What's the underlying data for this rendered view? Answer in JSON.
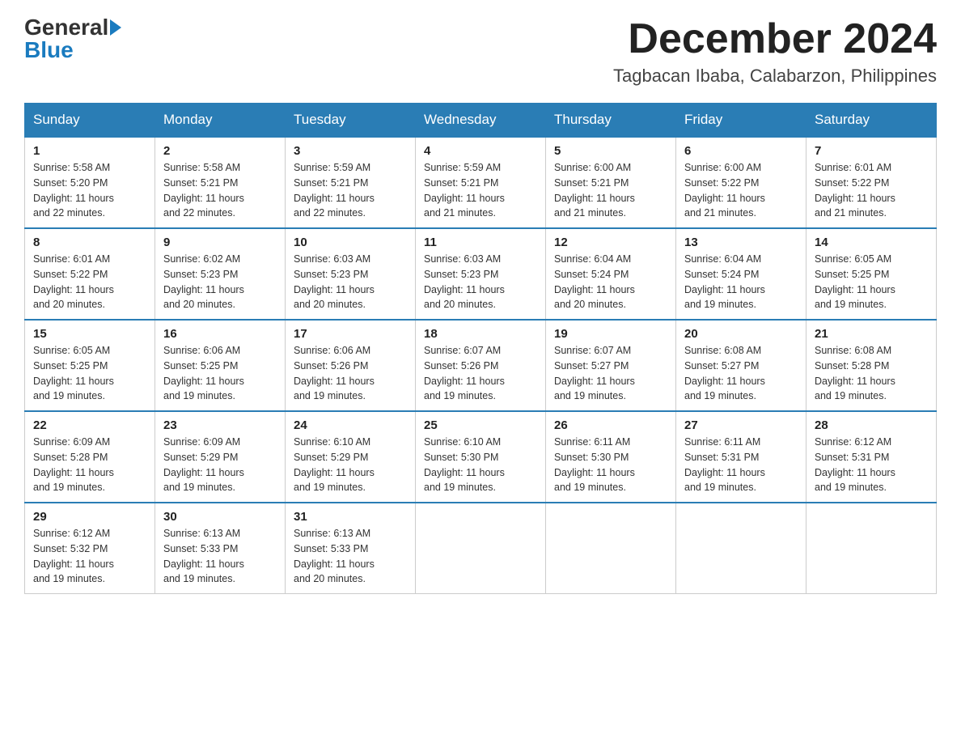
{
  "logo": {
    "general": "General",
    "blue": "Blue"
  },
  "header": {
    "month_year": "December 2024",
    "location": "Tagbacan Ibaba, Calabarzon, Philippines"
  },
  "days_of_week": [
    "Sunday",
    "Monday",
    "Tuesday",
    "Wednesday",
    "Thursday",
    "Friday",
    "Saturday"
  ],
  "weeks": [
    [
      {
        "day": "1",
        "sunrise": "5:58 AM",
        "sunset": "5:20 PM",
        "daylight": "11 hours and 22 minutes."
      },
      {
        "day": "2",
        "sunrise": "5:58 AM",
        "sunset": "5:21 PM",
        "daylight": "11 hours and 22 minutes."
      },
      {
        "day": "3",
        "sunrise": "5:59 AM",
        "sunset": "5:21 PM",
        "daylight": "11 hours and 22 minutes."
      },
      {
        "day": "4",
        "sunrise": "5:59 AM",
        "sunset": "5:21 PM",
        "daylight": "11 hours and 21 minutes."
      },
      {
        "day": "5",
        "sunrise": "6:00 AM",
        "sunset": "5:21 PM",
        "daylight": "11 hours and 21 minutes."
      },
      {
        "day": "6",
        "sunrise": "6:00 AM",
        "sunset": "5:22 PM",
        "daylight": "11 hours and 21 minutes."
      },
      {
        "day": "7",
        "sunrise": "6:01 AM",
        "sunset": "5:22 PM",
        "daylight": "11 hours and 21 minutes."
      }
    ],
    [
      {
        "day": "8",
        "sunrise": "6:01 AM",
        "sunset": "5:22 PM",
        "daylight": "11 hours and 20 minutes."
      },
      {
        "day": "9",
        "sunrise": "6:02 AM",
        "sunset": "5:23 PM",
        "daylight": "11 hours and 20 minutes."
      },
      {
        "day": "10",
        "sunrise": "6:03 AM",
        "sunset": "5:23 PM",
        "daylight": "11 hours and 20 minutes."
      },
      {
        "day": "11",
        "sunrise": "6:03 AM",
        "sunset": "5:23 PM",
        "daylight": "11 hours and 20 minutes."
      },
      {
        "day": "12",
        "sunrise": "6:04 AM",
        "sunset": "5:24 PM",
        "daylight": "11 hours and 20 minutes."
      },
      {
        "day": "13",
        "sunrise": "6:04 AM",
        "sunset": "5:24 PM",
        "daylight": "11 hours and 19 minutes."
      },
      {
        "day": "14",
        "sunrise": "6:05 AM",
        "sunset": "5:25 PM",
        "daylight": "11 hours and 19 minutes."
      }
    ],
    [
      {
        "day": "15",
        "sunrise": "6:05 AM",
        "sunset": "5:25 PM",
        "daylight": "11 hours and 19 minutes."
      },
      {
        "day": "16",
        "sunrise": "6:06 AM",
        "sunset": "5:25 PM",
        "daylight": "11 hours and 19 minutes."
      },
      {
        "day": "17",
        "sunrise": "6:06 AM",
        "sunset": "5:26 PM",
        "daylight": "11 hours and 19 minutes."
      },
      {
        "day": "18",
        "sunrise": "6:07 AM",
        "sunset": "5:26 PM",
        "daylight": "11 hours and 19 minutes."
      },
      {
        "day": "19",
        "sunrise": "6:07 AM",
        "sunset": "5:27 PM",
        "daylight": "11 hours and 19 minutes."
      },
      {
        "day": "20",
        "sunrise": "6:08 AM",
        "sunset": "5:27 PM",
        "daylight": "11 hours and 19 minutes."
      },
      {
        "day": "21",
        "sunrise": "6:08 AM",
        "sunset": "5:28 PM",
        "daylight": "11 hours and 19 minutes."
      }
    ],
    [
      {
        "day": "22",
        "sunrise": "6:09 AM",
        "sunset": "5:28 PM",
        "daylight": "11 hours and 19 minutes."
      },
      {
        "day": "23",
        "sunrise": "6:09 AM",
        "sunset": "5:29 PM",
        "daylight": "11 hours and 19 minutes."
      },
      {
        "day": "24",
        "sunrise": "6:10 AM",
        "sunset": "5:29 PM",
        "daylight": "11 hours and 19 minutes."
      },
      {
        "day": "25",
        "sunrise": "6:10 AM",
        "sunset": "5:30 PM",
        "daylight": "11 hours and 19 minutes."
      },
      {
        "day": "26",
        "sunrise": "6:11 AM",
        "sunset": "5:30 PM",
        "daylight": "11 hours and 19 minutes."
      },
      {
        "day": "27",
        "sunrise": "6:11 AM",
        "sunset": "5:31 PM",
        "daylight": "11 hours and 19 minutes."
      },
      {
        "day": "28",
        "sunrise": "6:12 AM",
        "sunset": "5:31 PM",
        "daylight": "11 hours and 19 minutes."
      }
    ],
    [
      {
        "day": "29",
        "sunrise": "6:12 AM",
        "sunset": "5:32 PM",
        "daylight": "11 hours and 19 minutes."
      },
      {
        "day": "30",
        "sunrise": "6:13 AM",
        "sunset": "5:33 PM",
        "daylight": "11 hours and 19 minutes."
      },
      {
        "day": "31",
        "sunrise": "6:13 AM",
        "sunset": "5:33 PM",
        "daylight": "11 hours and 20 minutes."
      },
      null,
      null,
      null,
      null
    ]
  ],
  "labels": {
    "sunrise": "Sunrise:",
    "sunset": "Sunset:",
    "daylight": "Daylight:"
  }
}
